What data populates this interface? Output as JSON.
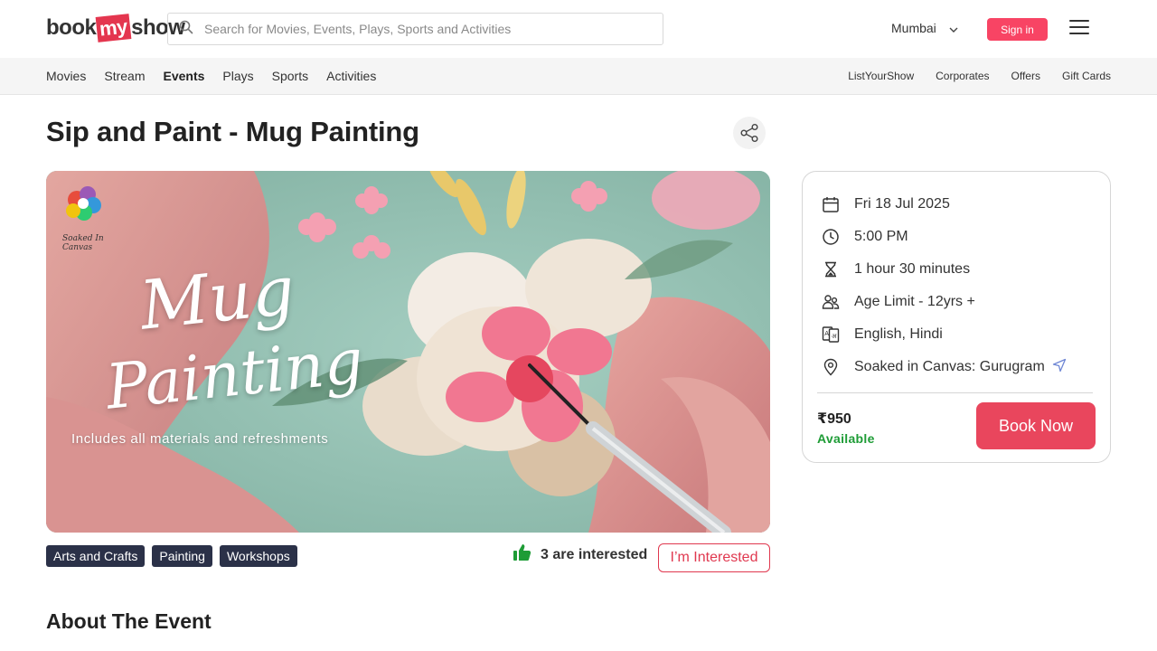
{
  "header": {
    "logo_pre": "book",
    "logo_my": "my",
    "logo_post": "show",
    "search_placeholder": "Search for Movies, Events, Plays, Sports and Activities",
    "city": "Mumbai",
    "signin_label": "Sign in"
  },
  "nav": {
    "left": [
      "Movies",
      "Stream",
      "Events",
      "Plays",
      "Sports",
      "Activities"
    ],
    "active": "Events",
    "right": [
      "ListYourShow",
      "Corporates",
      "Offers",
      "Gift Cards"
    ]
  },
  "event": {
    "title": "Sip and Paint - Mug Painting",
    "banner": {
      "line1": "Mug",
      "line2": "Painting",
      "subtitle": "Includes all materials and refreshments",
      "brand": "Soaked In Canvas"
    },
    "tags": [
      "Arts and Crafts",
      "Painting",
      "Workshops"
    ],
    "interest_count": "3 are interested",
    "interested_label": "I’m Interested",
    "about_heading": "About The Event"
  },
  "details": {
    "date": "Fri 18 Jul 2025",
    "time": "5:00 PM",
    "duration": "1 hour 30 minutes",
    "age": "Age Limit - 12yrs +",
    "language": "English, Hindi",
    "venue": "Soaked in Canvas: Gurugram",
    "price": "₹950",
    "availability": "Available",
    "book_label": "Book Now"
  },
  "colors": {
    "brand": "#f84464",
    "book": "#e9465d",
    "tag_bg": "#2b3148",
    "available": "#1e9c36"
  }
}
